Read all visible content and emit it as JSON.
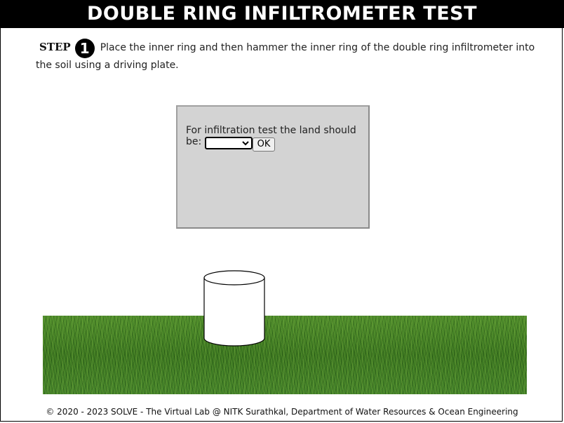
{
  "header": {
    "title": "DOUBLE RING INFILTROMETER TEST"
  },
  "step": {
    "label": "STEP",
    "number": "1",
    "instruction": "Place the inner ring and then hammer the inner ring of the double ring infiltrometer into the soil using a driving plate."
  },
  "dialog": {
    "prompt_line1": "For infiltration test the land should",
    "prompt_line2": "be:",
    "select_value": "",
    "ok_label": "OK"
  },
  "scene": {
    "ground_icon": "grass-field",
    "ring_icon": "inner-ring-cylinder",
    "grass_color": "#3e7a22"
  },
  "footer": {
    "text": "© 2020 - 2023 SOLVE - The Virtual Lab @ NITK Surathkal, Department of Water Resources & Ocean Engineering"
  }
}
